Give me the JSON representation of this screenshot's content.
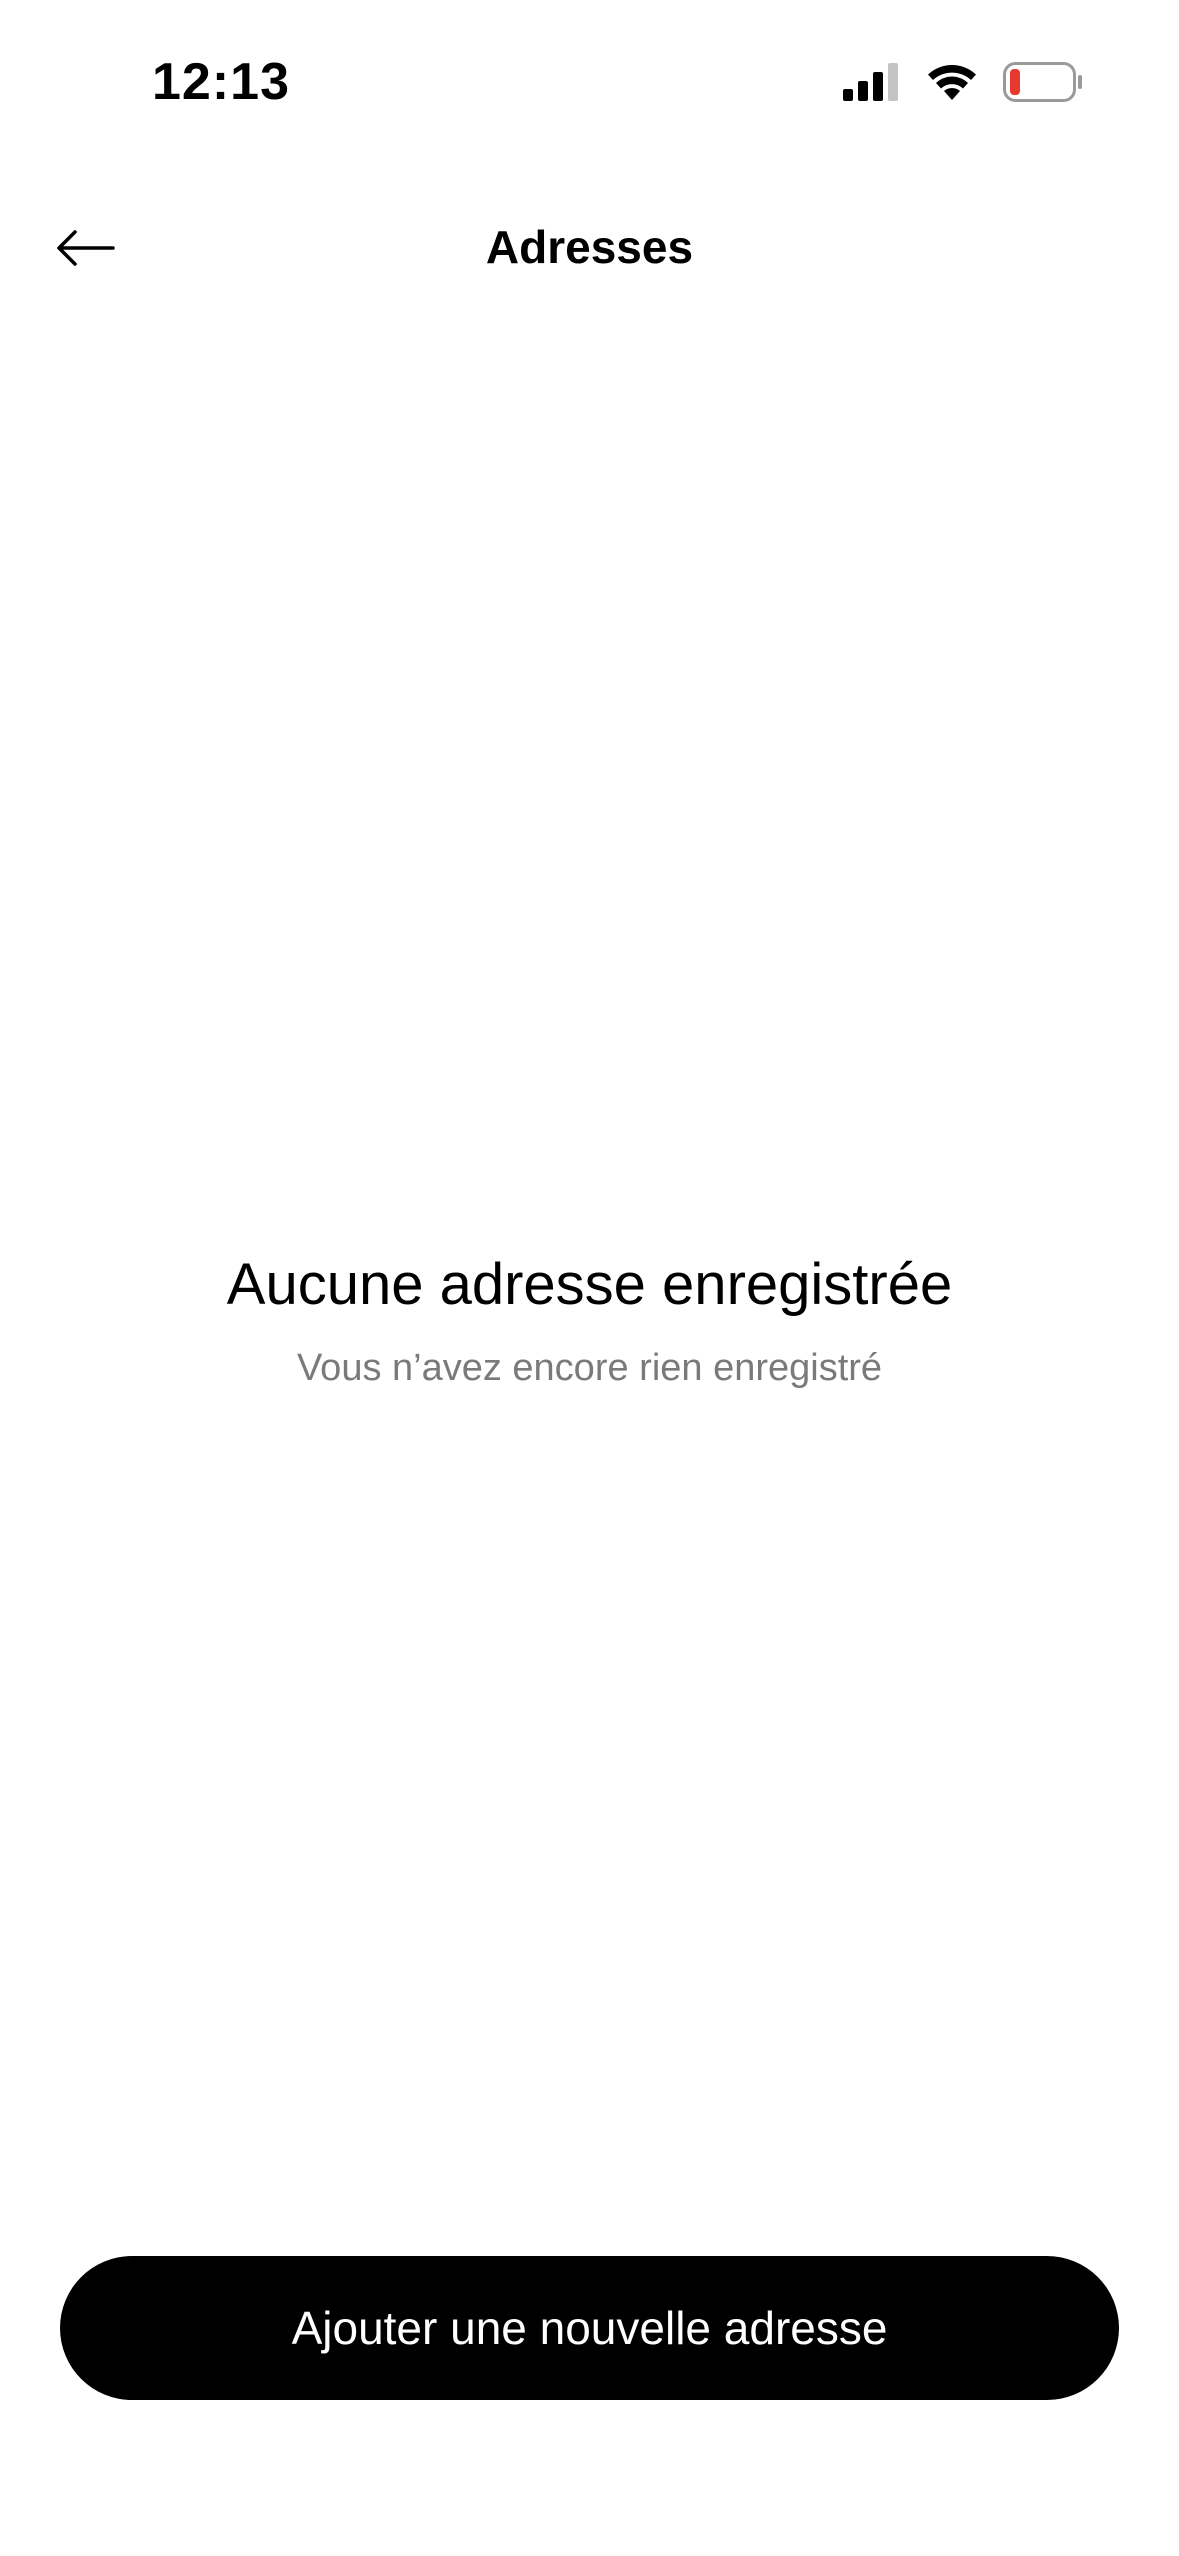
{
  "status_bar": {
    "time": "12:13"
  },
  "nav": {
    "title": "Adresses",
    "back_icon": "arrow-left-icon"
  },
  "empty_state": {
    "title": "Aucune adresse enregistrée",
    "subtitle": "Vous n’avez encore rien enregistré"
  },
  "cta": {
    "label": "Ajouter une nouvelle adresse"
  },
  "colors": {
    "background": "#ffffff",
    "text_primary": "#000000",
    "text_secondary": "#7a7a7a",
    "button_bg": "#000000",
    "button_text": "#ffffff",
    "battery_low": "#e8392f"
  },
  "icons": [
    "signal-icon",
    "wifi-icon",
    "battery-icon",
    "arrow-left-icon"
  ]
}
